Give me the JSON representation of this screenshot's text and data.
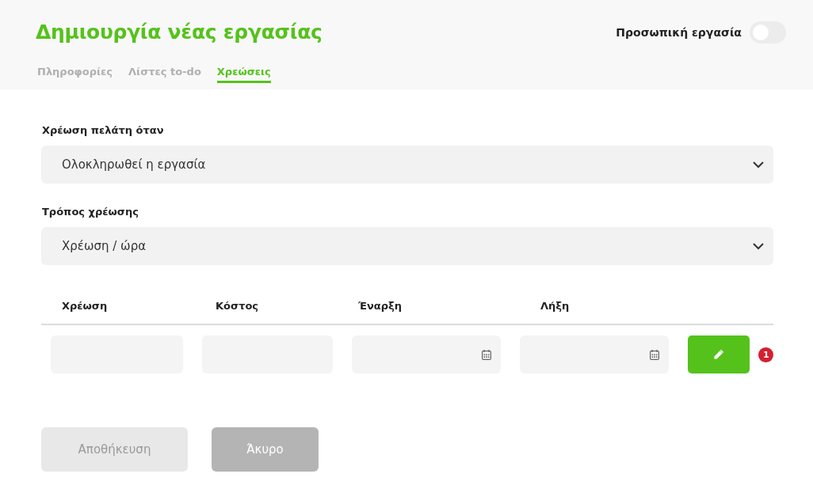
{
  "header": {
    "title": "Δημιουργία νέας εργασίας",
    "personal_task": {
      "label": "Προσωπική εργασία",
      "on": false
    }
  },
  "tabs": [
    {
      "label": "Πληροφορίες",
      "selected": false
    },
    {
      "label": "Λίστες to-do",
      "selected": false
    },
    {
      "label": "Χρεώσεις",
      "selected": true
    }
  ],
  "fields": [
    {
      "label": "Χρέωση πελάτη όταν",
      "value": "Ολοκληρωθεί η εργασία"
    },
    {
      "label": "Τρόπος χρέωσης",
      "value": "Χρέωση / ώρα"
    }
  ],
  "table": {
    "columns": [
      "Χρέωση",
      "Κόστος",
      "Έναρξη",
      "Λήξη"
    ],
    "inputs": [
      {
        "kind": "text"
      },
      {
        "kind": "text"
      },
      {
        "kind": "date"
      },
      {
        "kind": "date"
      }
    ],
    "edit_badge": "1"
  },
  "buttons": [
    {
      "label": "Αποθήκευση",
      "disabled": true
    },
    {
      "label": "Άκυρο",
      "disabled": false
    }
  ]
}
